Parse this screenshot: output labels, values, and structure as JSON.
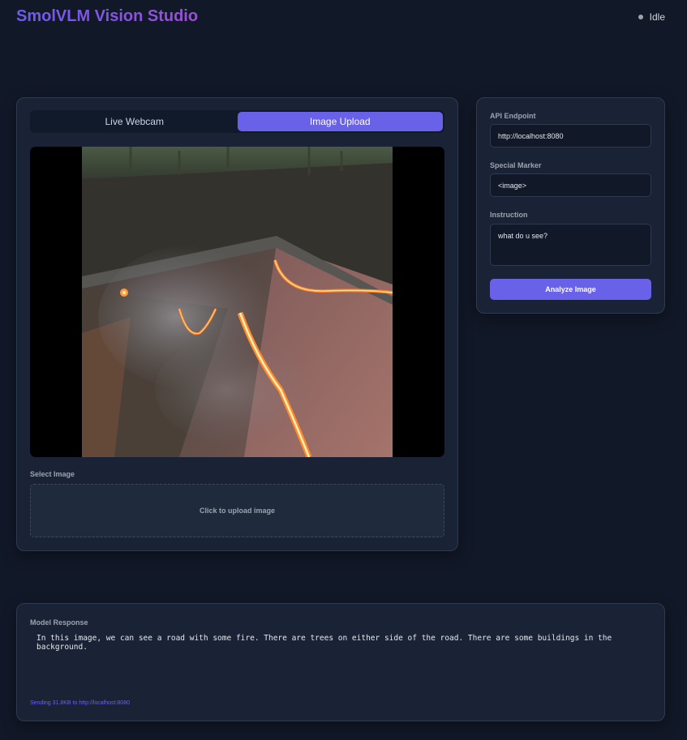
{
  "header": {
    "title": "SmolVLM Vision Studio",
    "status": "Idle"
  },
  "tabs": [
    {
      "label": "Live Webcam",
      "active": false
    },
    {
      "label": "Image Upload",
      "active": true
    }
  ],
  "upload": {
    "select_label": "Select Image",
    "dropzone_text": "Click to upload image"
  },
  "settings": {
    "api_label": "API Endpoint",
    "api_value": "http://localhost:8080",
    "marker_label": "Special Marker",
    "marker_value": "<image>",
    "instruction_label": "Instruction",
    "instruction_value": "what do u see?",
    "analyze_label": "Analyze Image"
  },
  "response": {
    "label": "Model Response",
    "text": "In this image, we can see a road with some fire. There are trees on either side of the road. There are some buildings in the background.",
    "footer": "Sending 31.8KB to http://localhost:8080"
  },
  "colors": {
    "background": "#111827",
    "card": "#1a2336",
    "accent": "#6962e8",
    "status_dot": "#9ca3af"
  }
}
